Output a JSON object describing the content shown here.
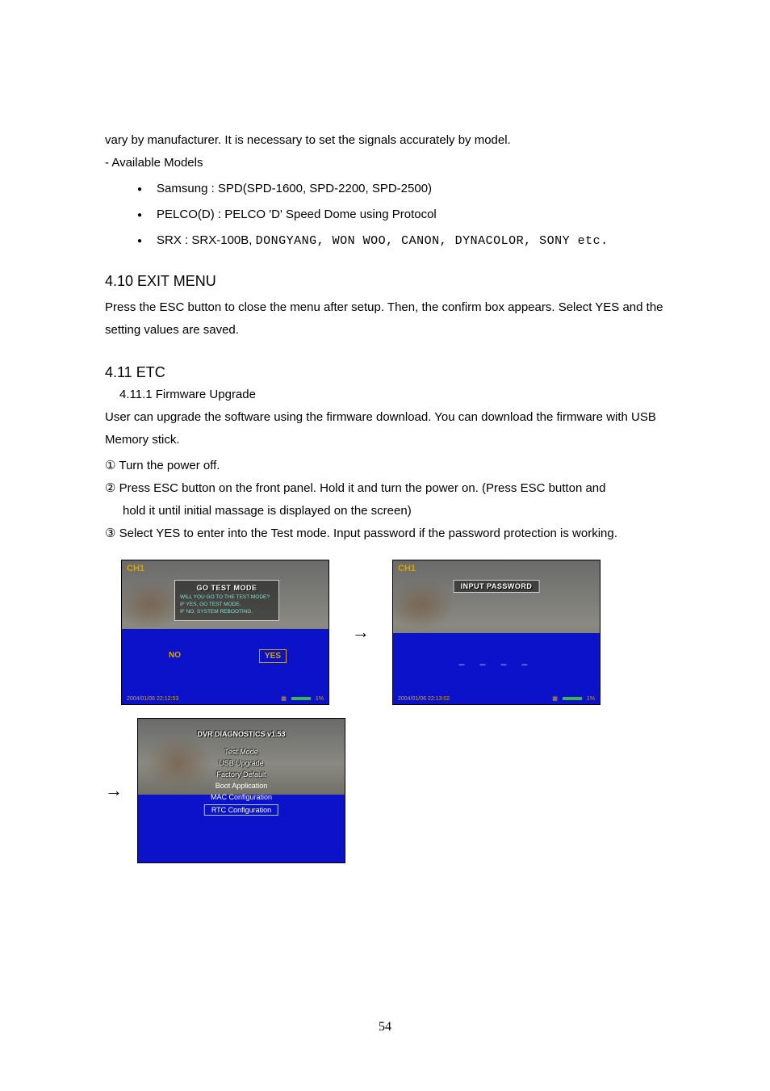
{
  "intro": {
    "line1": "vary by manufacturer. It is necessary to set the signals accurately by model.",
    "line2": "- Available Models"
  },
  "models": [
    {
      "prefix": "Samsung : ",
      "rest": "SPD(SPD-1600, SPD-2200, SPD-2500)",
      "mono": false
    },
    {
      "prefix": "PELCO(D) : ",
      "rest": "PELCO 'D' Speed Dome using Protocol",
      "mono": false
    },
    {
      "prefix": "SRX : SRX-100B, ",
      "rest": "DONGYANG, WON WOO, CANON, DYNACOLOR, SONY etc.",
      "mono": true
    }
  ],
  "section_exit": {
    "heading": "4.10 EXIT MENU",
    "body": "Press the ESC button to close the menu after setup. Then, the confirm box appears. Select YES and the setting values are saved."
  },
  "section_etc": {
    "heading": "4.11 ETC",
    "sub_heading": "4.11.1 Firmware Upgrade",
    "body": "User can upgrade the software using the firmware download. You can download the firmware with USB Memory stick.",
    "steps": [
      {
        "marker": "①",
        "text": "Turn the power off.",
        "indent": ""
      },
      {
        "marker": "②",
        "text": "Press ESC button on the front panel. Hold it and turn the power on. (Press ESC button and",
        "indent": "hold it until initial massage is displayed on the screen)"
      },
      {
        "marker": "③",
        "text": "Select YES to enter into the Test mode. Input password if the password protection is working.",
        "indent": ""
      }
    ]
  },
  "shot1": {
    "channel": "CH1",
    "dialog_title": "GO TEST MODE",
    "dialog_lines": [
      "WILL YOU GO TO THE TEST MODE?",
      "IF YES, GO TEST MODE.",
      "IF NO, SYSTEM REBOOTING."
    ],
    "no": "NO",
    "yes": "YES",
    "timestamp": "2004/01/06   22:12:53",
    "percent": "1%"
  },
  "shot2": {
    "channel": "CH1",
    "title": "INPUT PASSWORD",
    "timestamp": "2004/01/06   22:13:02",
    "percent": "1%"
  },
  "shot3": {
    "title": "DVR DIAGNOSTICS v1.53",
    "items": [
      {
        "label": "Test Mode",
        "style": "textured"
      },
      {
        "label": "USB Upgrade",
        "style": "textured"
      },
      {
        "label": "Factory Default",
        "style": "textured"
      },
      {
        "label": "Boot Application",
        "style": "plain"
      },
      {
        "label": "MAC Configuration",
        "style": "plain"
      },
      {
        "label": "RTC Configuration",
        "style": "boxed"
      }
    ]
  },
  "page_number": "54"
}
